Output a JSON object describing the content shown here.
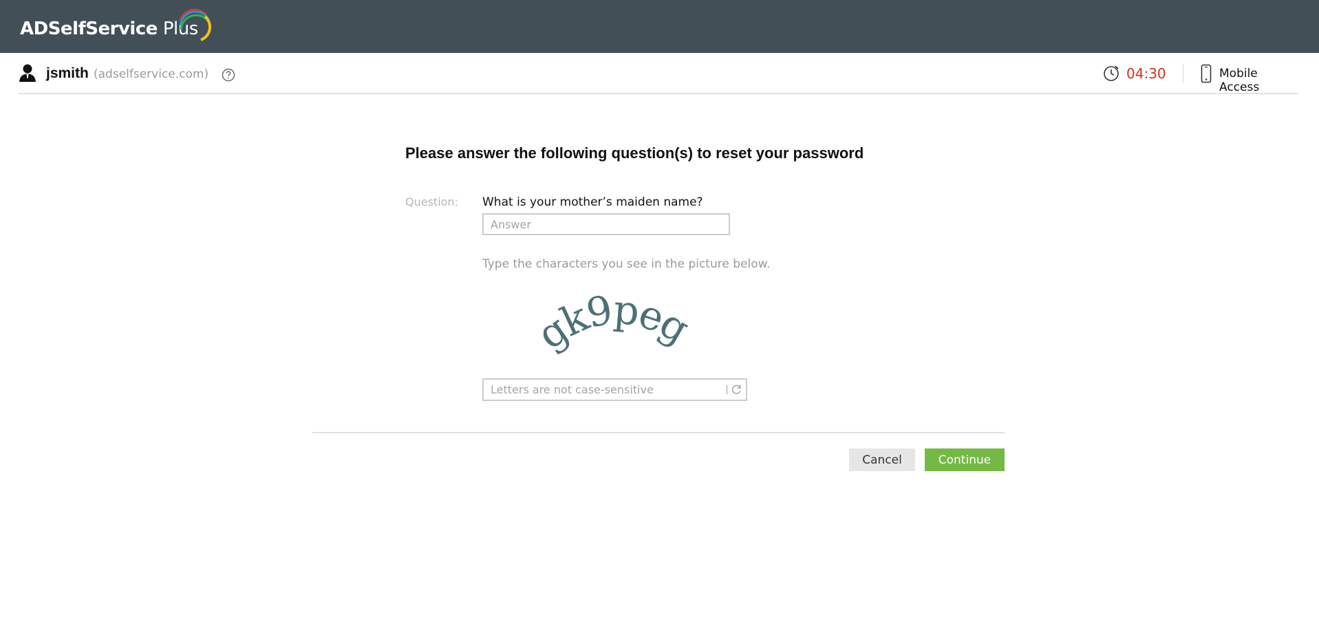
{
  "header": {
    "logo_brand": "ADSelfService",
    "logo_suffix": "Plus"
  },
  "userbar": {
    "username": "jsmith",
    "domain": "(adselfservice.com)",
    "timer": "04:30",
    "mobile_access_label": "Mobile Access"
  },
  "form": {
    "heading": "Please answer the following question(s) to reset your password",
    "question_label": "Question:",
    "question_text": "What is your mother’s maiden name?",
    "answer_placeholder": "Answer",
    "captcha_hint": "Type the characters you see in the picture below.",
    "captcha_text": "gk9peg",
    "captcha_placeholder": "Letters are not case-sensitive"
  },
  "actions": {
    "cancel_label": "Cancel",
    "continue_label": "Continue"
  },
  "colors": {
    "topbar": "#434f57",
    "timer": "#d3311b",
    "continue_button": "#74b944",
    "captcha_text": "#3d6469"
  },
  "icons": [
    "user-icon",
    "help-icon",
    "timer-icon",
    "phone-icon",
    "refresh-icon"
  ]
}
